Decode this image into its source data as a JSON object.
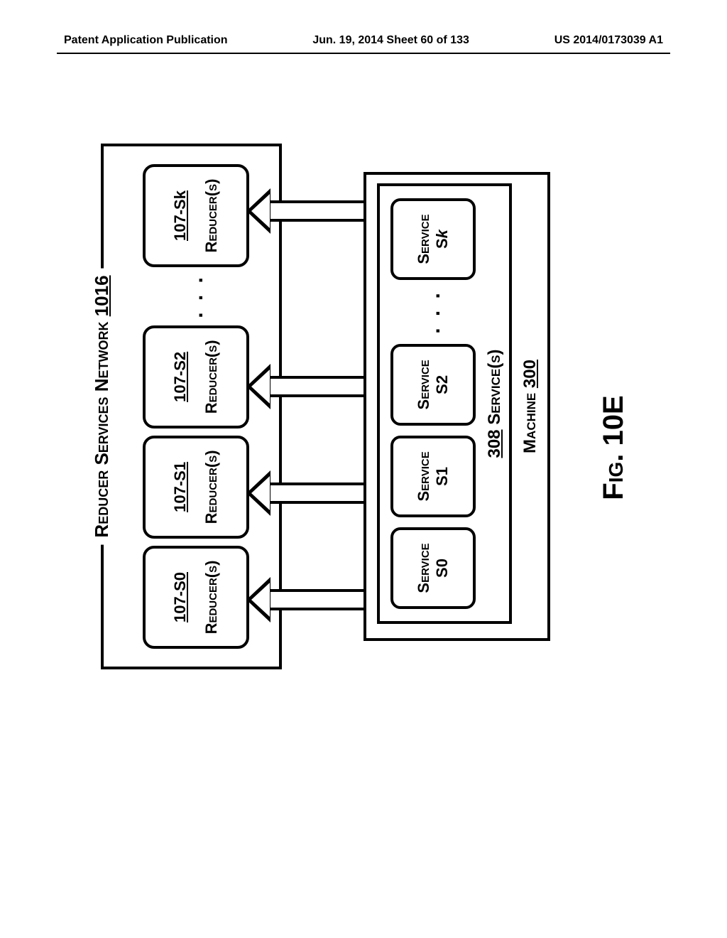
{
  "header": {
    "left": "Patent Application Publication",
    "center": "Jun. 19, 2014  Sheet 60 of 133",
    "right": "US 2014/0173039 A1"
  },
  "network": {
    "title_prefix": "Reducer Services Network",
    "title_num": "1016",
    "reducers": [
      {
        "ref": "107-S0",
        "label": "Reducer(s)"
      },
      {
        "ref": "107-S1",
        "label": "Reducer(s)"
      },
      {
        "ref": "107-S2",
        "label": "Reducer(s)"
      },
      {
        "ref": "107-Sk",
        "label": "Reducer(s)"
      }
    ],
    "ellipsis": ". . ."
  },
  "machine": {
    "label_prefix": "Machine",
    "label_num": "300",
    "services_label_num": "308",
    "services_label_text": "Service(s)",
    "services": [
      {
        "label": "Service",
        "id": "S0",
        "italic_k": false
      },
      {
        "label": "Service",
        "id": "S1",
        "italic_k": false
      },
      {
        "label": "Service",
        "id": "S2",
        "italic_k": false
      },
      {
        "label": "Service",
        "id": "Sk",
        "italic_k": true
      }
    ],
    "ellipsis": ". . ."
  },
  "figure_label": "Fig. 10E"
}
